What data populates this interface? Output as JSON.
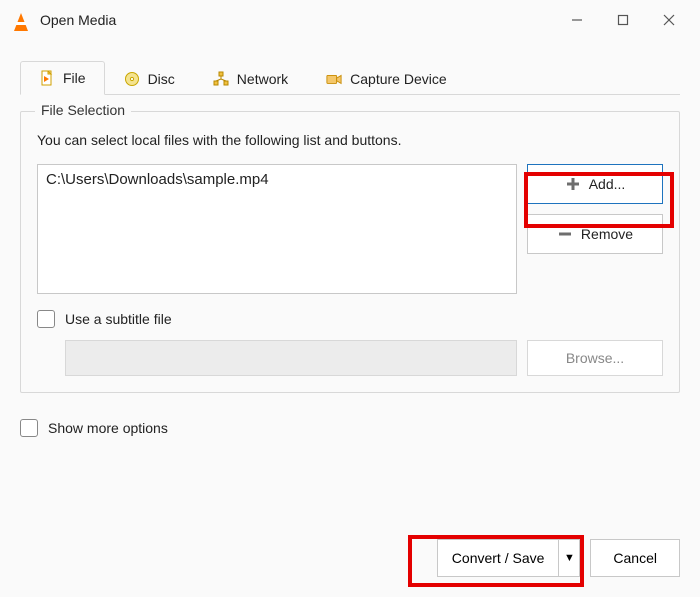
{
  "window": {
    "title": "Open Media"
  },
  "tabs": [
    {
      "label": "File"
    },
    {
      "label": "Disc"
    },
    {
      "label": "Network"
    },
    {
      "label": "Capture Device"
    }
  ],
  "fileSelection": {
    "legend": "File Selection",
    "desc": "You can select local files with the following list and buttons.",
    "files": [
      "C:\\Users\\Downloads\\sample.mp4"
    ],
    "addLabel": "Add...",
    "removeLabel": "Remove",
    "subtitleCheckboxLabel": "Use a subtitle file",
    "browseLabel": "Browse..."
  },
  "bottom": {
    "moreOptionsLabel": "Show more options"
  },
  "footer": {
    "convertLabel": "Convert / Save",
    "dropdownGlyph": "▼",
    "cancelLabel": "Cancel"
  }
}
